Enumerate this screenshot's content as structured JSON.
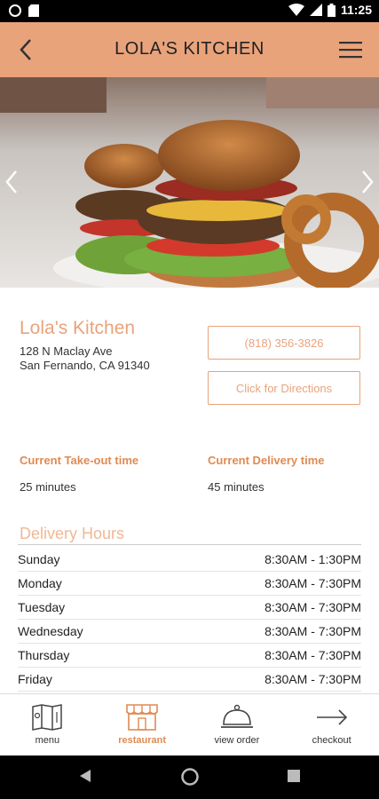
{
  "status_bar": {
    "time": "11:25"
  },
  "header": {
    "title": "LOLA'S KITCHEN"
  },
  "restaurant": {
    "name": "Lola's Kitchen",
    "address_line1": "128 N Maclay Ave",
    "address_line2": "San Fernando, CA 91340",
    "phone_button": "(818) 356-3826",
    "directions_button": "Click for Directions"
  },
  "times": {
    "takeout_label": "Current Take-out time",
    "takeout_value": "25 minutes",
    "delivery_label": "Current Delivery time",
    "delivery_value": "45 minutes"
  },
  "delivery_hours": {
    "title": "Delivery Hours",
    "rows": [
      {
        "day": "Sunday",
        "hours": "8:30AM - 1:30PM"
      },
      {
        "day": "Monday",
        "hours": "8:30AM - 7:30PM"
      },
      {
        "day": "Tuesday",
        "hours": "8:30AM - 7:30PM"
      },
      {
        "day": "Wednesday",
        "hours": "8:30AM - 7:30PM"
      },
      {
        "day": "Thursday",
        "hours": "8:30AM - 7:30PM"
      },
      {
        "day": "Friday",
        "hours": "8:30AM - 7:30PM"
      }
    ]
  },
  "bottom_nav": [
    {
      "label": "menu",
      "icon": "menu-book-icon"
    },
    {
      "label": "restaurant",
      "icon": "storefront-icon",
      "active": true
    },
    {
      "label": "view order",
      "icon": "cloche-icon"
    },
    {
      "label": "checkout",
      "icon": "arrow-right-icon"
    }
  ],
  "colors": {
    "accent": "#E9A37B",
    "accent_dark": "#E08A54"
  }
}
